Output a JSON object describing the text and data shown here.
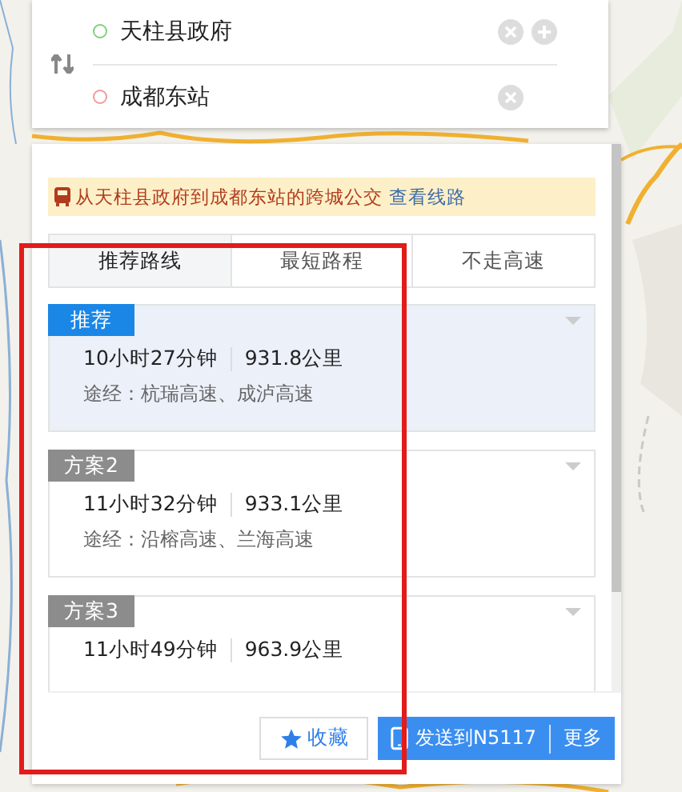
{
  "search": {
    "origin": "天柱县政府",
    "destination": "成都东站"
  },
  "banner": {
    "text": "从天柱县政府到成都东站的跨城公交",
    "link": "查看线路"
  },
  "tabs": [
    {
      "label": "推荐路线",
      "selected": true
    },
    {
      "label": "最短路程",
      "selected": false
    },
    {
      "label": "不走高速",
      "selected": false
    }
  ],
  "routes": [
    {
      "tag": "推荐",
      "selected": true,
      "time": "10小时27分钟",
      "distance": "931.8公里",
      "via": "途经：杭瑞高速、成泸高速"
    },
    {
      "tag": "方案2",
      "selected": false,
      "time": "11小时32分钟",
      "distance": "933.1公里",
      "via": "途经：沿榕高速、兰海高速"
    },
    {
      "tag": "方案3",
      "selected": false,
      "time": "11小时49分钟",
      "distance": "963.9公里"
    }
  ],
  "buttons": {
    "favorite": "收藏",
    "send": "发送到N5117",
    "more": "更多"
  }
}
